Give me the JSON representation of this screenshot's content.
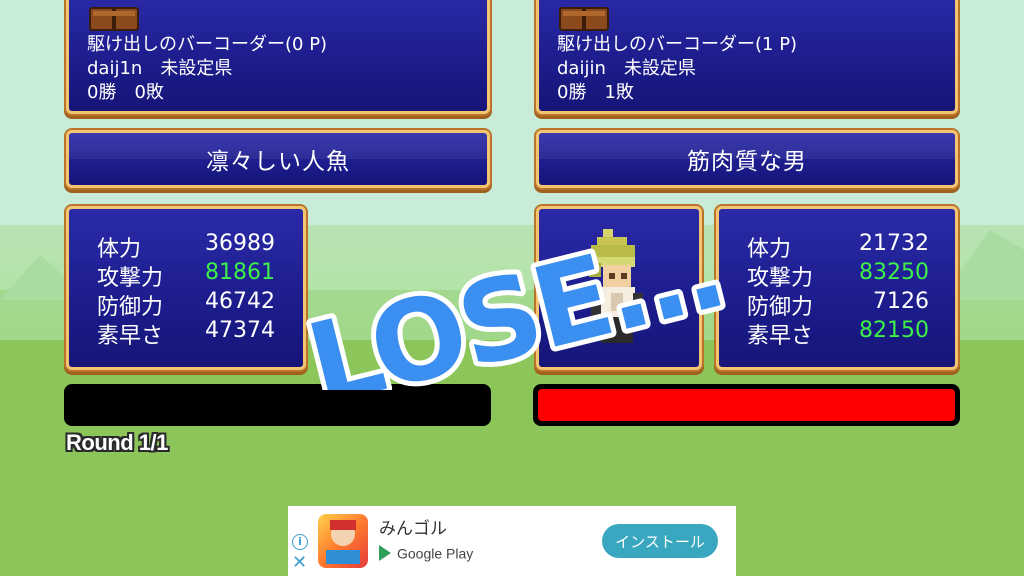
{
  "player_left": {
    "title": "駆け出しのバーコーダー(0 P)",
    "user": "daij1n　未設定県",
    "record": "0勝　0敗",
    "character_name": "凛々しい人魚",
    "stats": [
      {
        "label": "体力",
        "value": "36989",
        "highlight": false
      },
      {
        "label": "攻撃力",
        "value": "81861",
        "highlight": true
      },
      {
        "label": "防御力",
        "value": "46742",
        "highlight": false
      },
      {
        "label": "素早さ",
        "value": "47374",
        "highlight": false
      }
    ],
    "hp_fraction": 0.0
  },
  "player_right": {
    "title": "駆け出しのバーコーダー(1 P)",
    "user": "daijin　未設定県",
    "record": "0勝　1敗",
    "character_name": "筋肉質な男",
    "stats": [
      {
        "label": "体力",
        "value": "21732",
        "highlight": false
      },
      {
        "label": "攻撃力",
        "value": "83250",
        "highlight": true
      },
      {
        "label": "防御力",
        "value": "7126",
        "highlight": false
      },
      {
        "label": "素早さ",
        "value": "82150",
        "highlight": true
      }
    ],
    "hp_fraction": 1.0
  },
  "round_text": "Round 1/1",
  "result_text": "LOSE...",
  "colors": {
    "panel_bg": "#1c1c8c",
    "panel_border": "#f4c470",
    "highlight_stat": "#3ef04a",
    "hp_bar": "#ff0000",
    "lose_text": "#3a8ff0"
  },
  "ad": {
    "app_name": "みんゴル",
    "store_label": "Google Play",
    "install_label": "インストール",
    "info_icon": "info-icon",
    "close_icon": "close-icon"
  }
}
